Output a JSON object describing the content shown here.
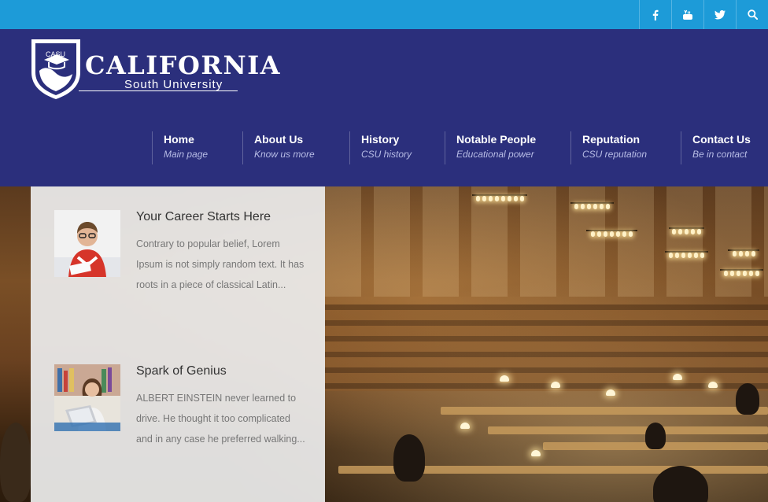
{
  "social": [
    {
      "icon": "facebook-icon",
      "label": "f"
    },
    {
      "icon": "youtube-icon",
      "label": "You Tube"
    },
    {
      "icon": "twitter-icon",
      "label": ""
    },
    {
      "icon": "search-icon",
      "label": ""
    }
  ],
  "logo": {
    "badge": "CASU",
    "name": "California",
    "sub": "South University"
  },
  "nav": [
    {
      "title": "Home",
      "sub": "Main page"
    },
    {
      "title": "About Us",
      "sub": "Know us more"
    },
    {
      "title": "History",
      "sub": "CSU history"
    },
    {
      "title": "Notable People",
      "sub": "Educational power"
    },
    {
      "title": "Reputation",
      "sub": "CSU reputation"
    },
    {
      "title": "Contact Us",
      "sub": "Be in contact"
    }
  ],
  "posts": [
    {
      "title": "Your Career Starts Here",
      "text": "Contrary to popular belief, Lorem Ipsum is not simply random text. It has roots in a piece of classical Latin..."
    },
    {
      "title": "Spark of Genius",
      "text": "ALBERT EINSTEIN never learned to drive. He thought it too complicated and in any case he preferred walking..."
    }
  ],
  "colors": {
    "topbar": "#1d9bd8",
    "header": "#2b2f7c",
    "panel": "#ececec"
  }
}
